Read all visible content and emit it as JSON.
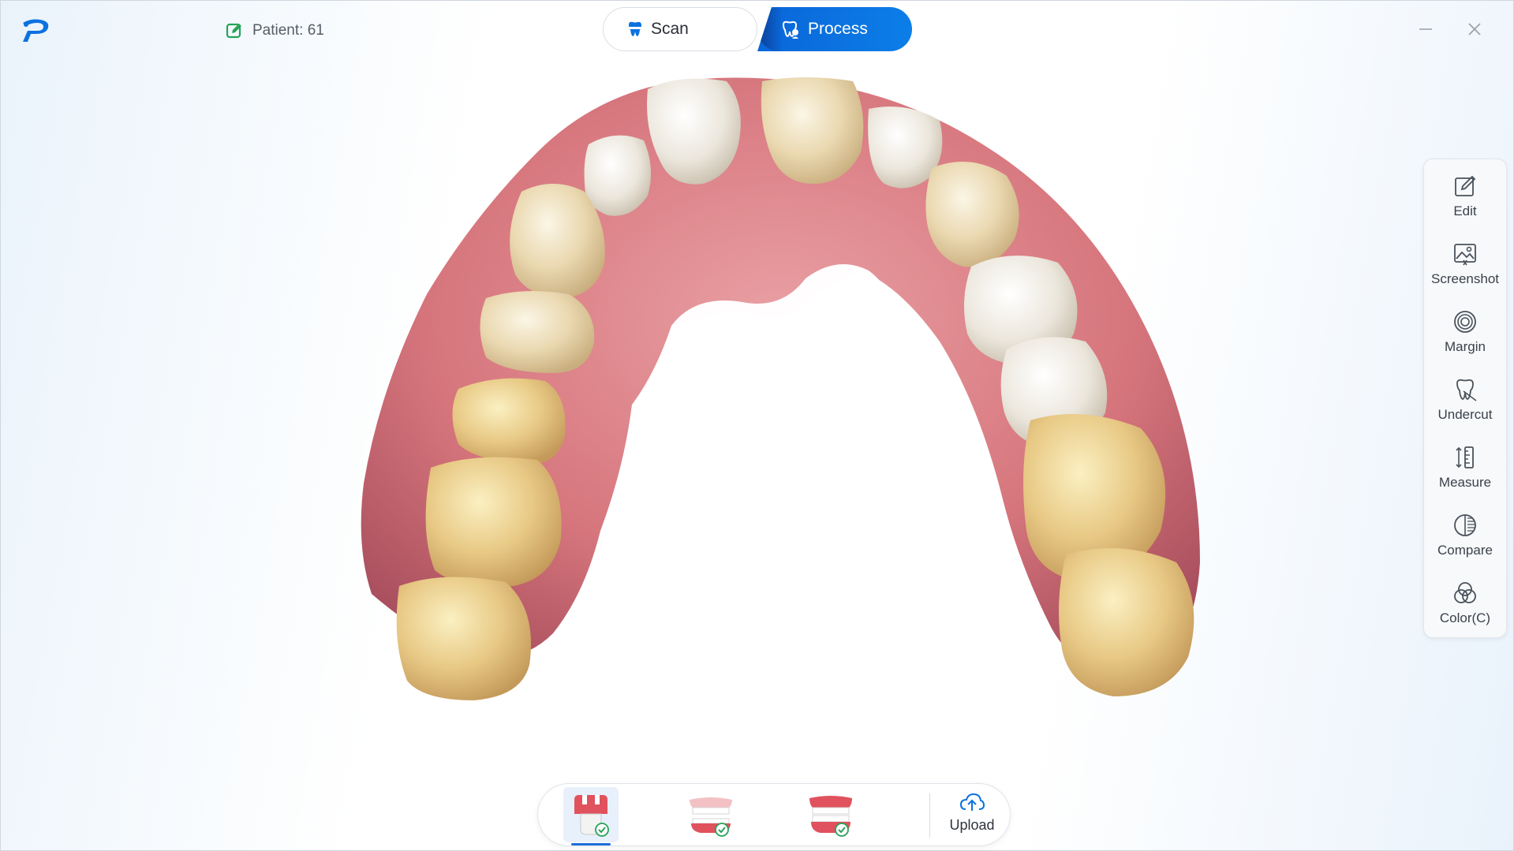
{
  "header": {
    "patient_label": "Patient: 61",
    "tabs": [
      {
        "label": "Scan",
        "icon": "tooth-icon",
        "active": false
      },
      {
        "label": "Process",
        "icon": "tooth-process-icon",
        "active": true
      }
    ]
  },
  "tools": [
    {
      "label": "Edit",
      "icon": "edit-icon"
    },
    {
      "label": "Screenshot",
      "icon": "screenshot-icon"
    },
    {
      "label": "Margin",
      "icon": "margin-icon"
    },
    {
      "label": "Undercut",
      "icon": "undercut-icon"
    },
    {
      "label": "Measure",
      "icon": "measure-icon"
    },
    {
      "label": "Compare",
      "icon": "compare-icon"
    },
    {
      "label": "Color(C)",
      "icon": "color-icon"
    }
  ],
  "bottom_bar": {
    "items": [
      {
        "icon": "prep-tooth-icon",
        "status": "done",
        "active": true
      },
      {
        "icon": "upper-jaw-icon",
        "status": "done",
        "active": false
      },
      {
        "icon": "bite-icon",
        "status": "done",
        "active": false
      }
    ],
    "upload_label": "Upload"
  },
  "colors": {
    "accent": "#0c72e0",
    "accent_dark": "#0a3f92",
    "gum": "#d8737a",
    "tooth": "#efe3c2"
  }
}
